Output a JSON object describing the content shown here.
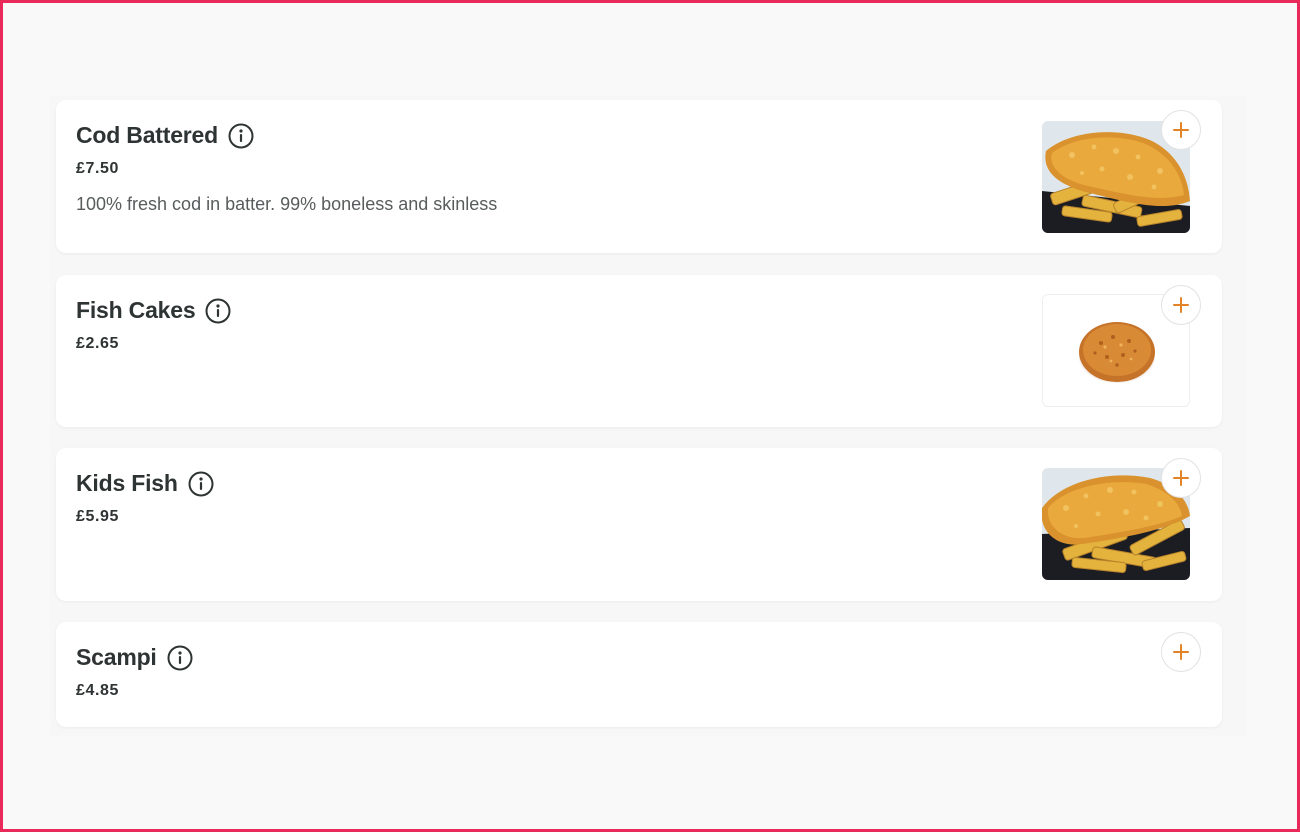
{
  "colors": {
    "frame": "#e8295a",
    "accent": "#e2832a",
    "text": "#2e3333",
    "muted": "#585c5c"
  },
  "items": [
    {
      "name": "Cod Battered",
      "price": "£7.50",
      "description": "100% fresh cod in batter. 99% boneless and skinless",
      "image": "fish-and-chips-photo"
    },
    {
      "name": "Fish Cakes",
      "price": "£2.65",
      "description": "",
      "image": "fish-cake-photo"
    },
    {
      "name": "Kids Fish",
      "price": "£5.95",
      "description": "",
      "image": "fish-and-chips-photo"
    },
    {
      "name": "Scampi",
      "price": "£4.85",
      "description": "",
      "image": ""
    }
  ],
  "icons": {
    "info": "info-icon",
    "add": "plus-icon"
  }
}
